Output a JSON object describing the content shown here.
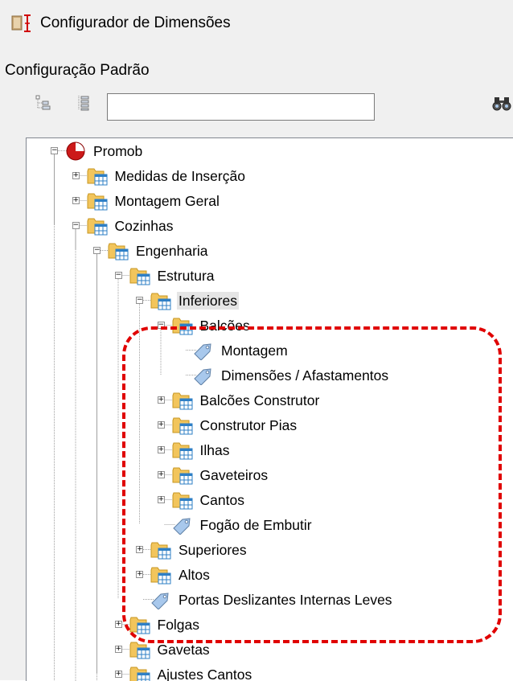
{
  "window": {
    "title": "Configurador de Dimensões",
    "icon": "dimension-config-icon"
  },
  "panel": {
    "title": "Configuração Padrão"
  },
  "toolbar": {
    "expand_icon": "expand-all-icon",
    "collapse_icon": "collapse-all-icon",
    "search_value": "",
    "find_icon": "binoculars-icon"
  },
  "tree": {
    "nodes": [
      {
        "label": "Promob",
        "depth": 0,
        "expander": "minus",
        "icon": "promob-logo-icon"
      },
      {
        "label": "Medidas de Inserção",
        "depth": 1,
        "expander": "plus",
        "icon": "folder-table-icon"
      },
      {
        "label": "Montagem Geral",
        "depth": 1,
        "expander": "plus",
        "icon": "folder-table-icon"
      },
      {
        "label": "Cozinhas",
        "depth": 1,
        "expander": "minus",
        "icon": "folder-table-icon"
      },
      {
        "label": "Engenharia",
        "depth": 2,
        "expander": "minus",
        "icon": "folder-table-icon"
      },
      {
        "label": "Estrutura",
        "depth": 3,
        "expander": "minus",
        "icon": "folder-table-icon"
      },
      {
        "label": "Inferiores",
        "depth": 4,
        "expander": "minus",
        "icon": "folder-table-icon",
        "selected": true
      },
      {
        "label": "Balcões",
        "depth": 5,
        "expander": "minus",
        "icon": "folder-table-icon"
      },
      {
        "label": "Montagem",
        "depth": 6,
        "expander": "none",
        "icon": "tag-icon"
      },
      {
        "label": "Dimensões / Afastamentos",
        "depth": 6,
        "expander": "none",
        "icon": "tag-icon"
      },
      {
        "label": "Balcões Construtor",
        "depth": 5,
        "expander": "plus",
        "icon": "folder-table-icon"
      },
      {
        "label": "Construtor Pias",
        "depth": 5,
        "expander": "plus",
        "icon": "folder-table-icon"
      },
      {
        "label": "Ilhas",
        "depth": 5,
        "expander": "plus",
        "icon": "folder-table-icon"
      },
      {
        "label": "Gaveteiros",
        "depth": 5,
        "expander": "plus",
        "icon": "folder-table-icon"
      },
      {
        "label": "Cantos",
        "depth": 5,
        "expander": "plus",
        "icon": "folder-table-icon"
      },
      {
        "label": "Fogão de Embutir",
        "depth": 5,
        "expander": "none",
        "icon": "tag-icon"
      },
      {
        "label": "Superiores",
        "depth": 4,
        "expander": "plus",
        "icon": "folder-table-icon"
      },
      {
        "label": "Altos",
        "depth": 4,
        "expander": "plus",
        "icon": "folder-table-icon"
      },
      {
        "label": "Portas Deslizantes Internas Leves",
        "depth": 4,
        "expander": "none",
        "icon": "tag-icon"
      },
      {
        "label": "Folgas",
        "depth": 3,
        "expander": "plus",
        "icon": "folder-table-icon"
      },
      {
        "label": "Gavetas",
        "depth": 3,
        "expander": "plus",
        "icon": "folder-table-icon"
      },
      {
        "label": "Ajustes Cantos",
        "depth": 3,
        "expander": "plus",
        "icon": "folder-table-icon"
      }
    ]
  },
  "annotation": {
    "style": "dashed-rounded-rectangle",
    "color": "#e00000"
  }
}
